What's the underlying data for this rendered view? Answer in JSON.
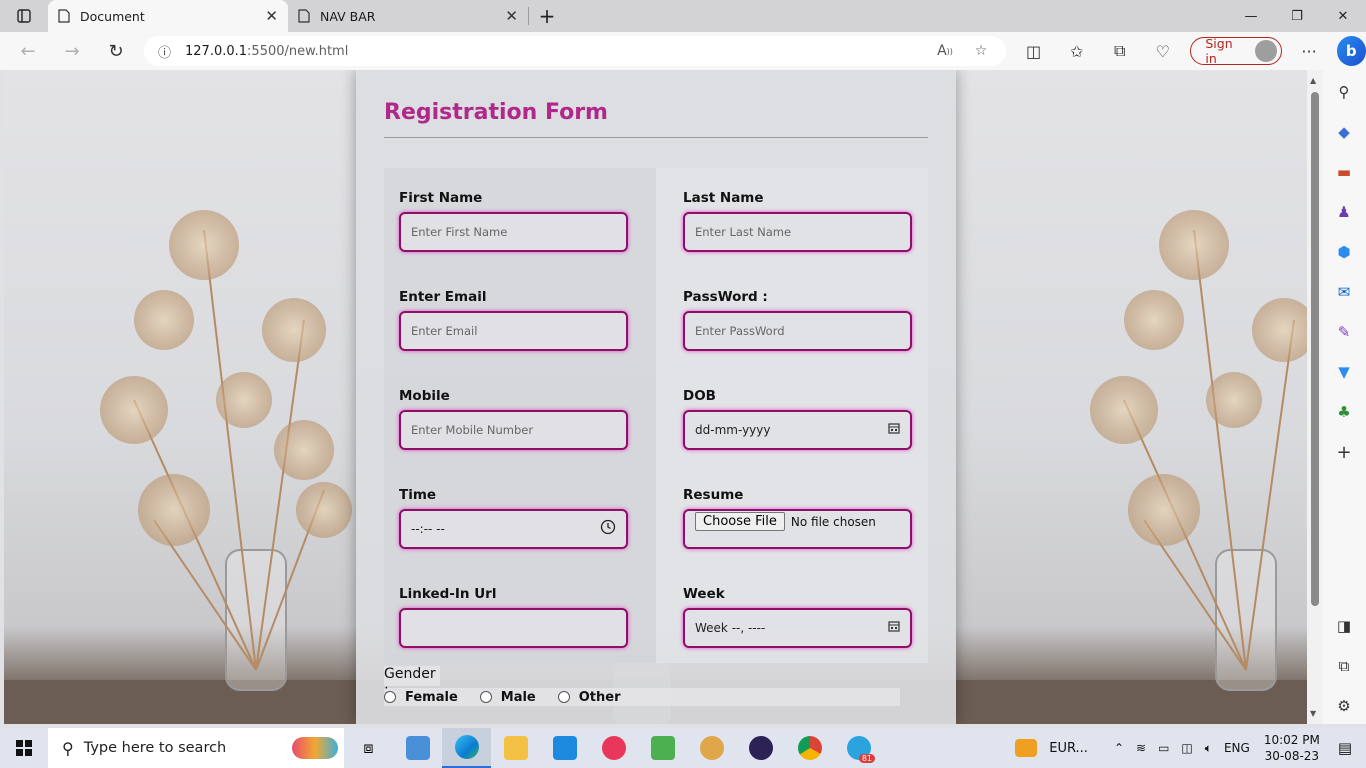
{
  "browser": {
    "tabs": [
      {
        "title": "Document",
        "active": true
      },
      {
        "title": "NAV BAR",
        "active": false
      }
    ],
    "url_host": "127.0.0.1",
    "url_rest": ":5500/new.html",
    "sign_in_label": "Sign in"
  },
  "form": {
    "title": "Registration Form",
    "fields": [
      {
        "label": "First Name",
        "placeholder": "Enter First Name"
      },
      {
        "label": "Last Name",
        "placeholder": "Enter Last Name"
      },
      {
        "label": "Enter Email",
        "placeholder": "Enter Email"
      },
      {
        "label": "PassWord :",
        "placeholder": "Enter PassWord"
      },
      {
        "label": "Mobile",
        "placeholder": "Enter Mobile Number"
      },
      {
        "label": "DOB",
        "value": "dd-mm-yyyy"
      },
      {
        "label": "Time",
        "value": "--:-- --"
      },
      {
        "label": "Resume",
        "button": "Choose File",
        "status": "No file chosen"
      },
      {
        "label": "Linked-In Url",
        "placeholder": ""
      },
      {
        "label": "Week",
        "value": "Week --, ----"
      }
    ],
    "gender_label": "Gender :",
    "gender_options": [
      "Female",
      "Male",
      "Other"
    ]
  },
  "taskbar": {
    "search_placeholder": "Type here to search",
    "weather_text": "EUR...",
    "language": "ENG",
    "time": "10:02 PM",
    "date": "30-08-23",
    "telegram_badge": "81"
  },
  "colors": {
    "title": "#b0298a",
    "field_border": "#8e0f66",
    "signin": "#b4261e"
  }
}
